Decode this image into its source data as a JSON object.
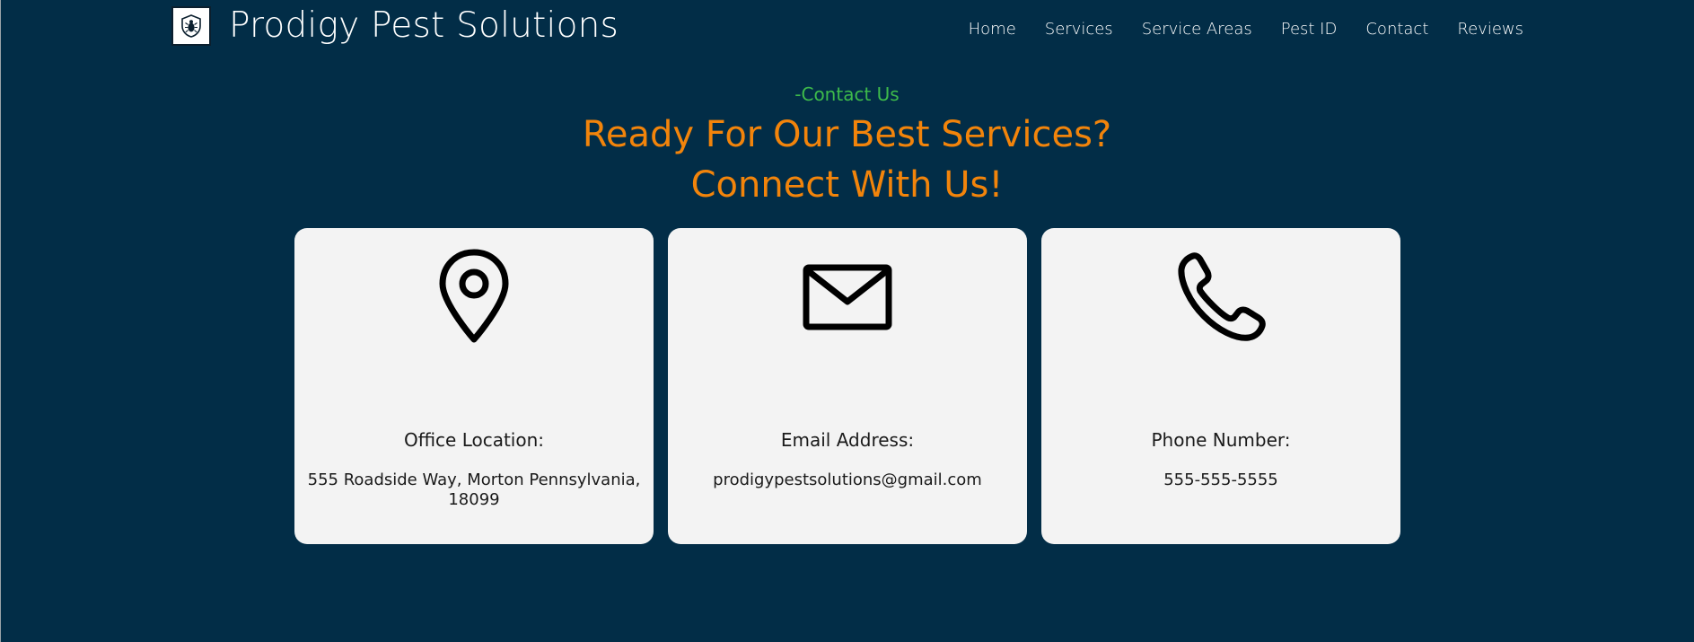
{
  "header": {
    "brand": "Prodigy Pest Solutions",
    "logo_icon": "bug-shield-icon",
    "nav": [
      {
        "label": "Home"
      },
      {
        "label": "Services"
      },
      {
        "label": "Service Areas"
      },
      {
        "label": "Pest ID"
      },
      {
        "label": "Contact"
      },
      {
        "label": "Reviews"
      }
    ]
  },
  "contact": {
    "eyebrow": "-Contact Us",
    "headline_line1": "Ready For Our Best Services?",
    "headline_line2": "Connect With Us!",
    "cards": [
      {
        "icon": "map-pin-icon",
        "title": "Office Location:",
        "value": "555 Roadside Way, Morton Pennsylvania, 18099"
      },
      {
        "icon": "mail-icon",
        "title": "Email Address:",
        "value": "prodigypestsolutions@gmail.com"
      },
      {
        "icon": "phone-icon",
        "title": "Phone Number:",
        "value": "555-555-5555"
      }
    ]
  },
  "colors": {
    "background": "#022D47",
    "accent_green": "#3EBB4B",
    "accent_orange": "#F2840B",
    "card_bg": "#F3F3F3"
  }
}
